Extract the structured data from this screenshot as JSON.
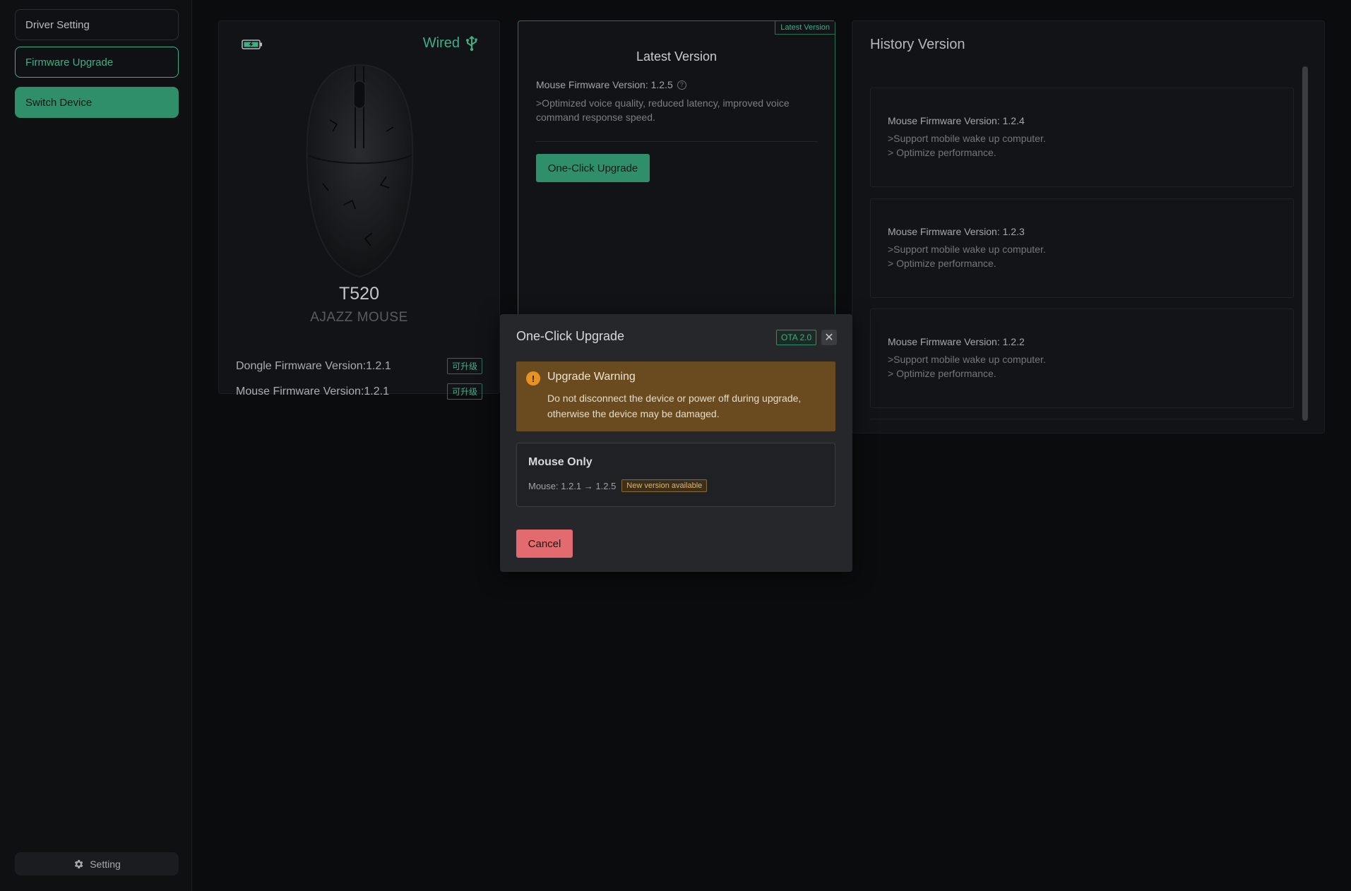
{
  "sidebar": {
    "items": [
      {
        "label": "Driver Setting"
      },
      {
        "label": "Firmware Upgrade"
      },
      {
        "label": "Switch Device"
      }
    ],
    "setting_label": "Setting"
  },
  "device": {
    "connection": "Wired",
    "model": "T520",
    "brand": "AJAZZ MOUSE",
    "dongle_fw": "Dongle Firmware Version:1.2.1",
    "mouse_fw": "Mouse Firmware Version:1.2.1",
    "upgradable_tag": "可升级"
  },
  "latest": {
    "badge": "Latest Version",
    "title": "Latest Version",
    "version": "Mouse Firmware Version: 1.2.5",
    "description": ">Optimized voice quality, reduced latency, improved voice command response speed.",
    "button": "One-Click Upgrade"
  },
  "history": {
    "title": "History Version",
    "items": [
      {
        "version": "Mouse Firmware Version: 1.2.4",
        "note1": ">Support mobile wake up computer.",
        "note2": "> Optimize performance."
      },
      {
        "version": "Mouse Firmware Version: 1.2.3",
        "note1": ">Support mobile wake up computer.",
        "note2": "> Optimize performance."
      },
      {
        "version": "Mouse Firmware Version: 1.2.2",
        "note1": ">Support mobile wake up computer.",
        "note2": "> Optimize performance."
      }
    ]
  },
  "dialog": {
    "title": "One-Click Upgrade",
    "ota_badge": "OTA 2.0",
    "warning_title": "Upgrade Warning",
    "warning_text": "Do not disconnect the device or power off during upgrade, otherwise the device may be damaged.",
    "mode_title": "Mouse Only",
    "mode_line": "Mouse: 1.2.1 → 1.2.5",
    "new_badge": "New version available",
    "cancel": "Cancel"
  },
  "colors": {
    "accent": "#3fae85",
    "accent_fill": "#2f8f6a",
    "warning_bg": "#6a4a1f",
    "cancel": "#e26b6f"
  }
}
